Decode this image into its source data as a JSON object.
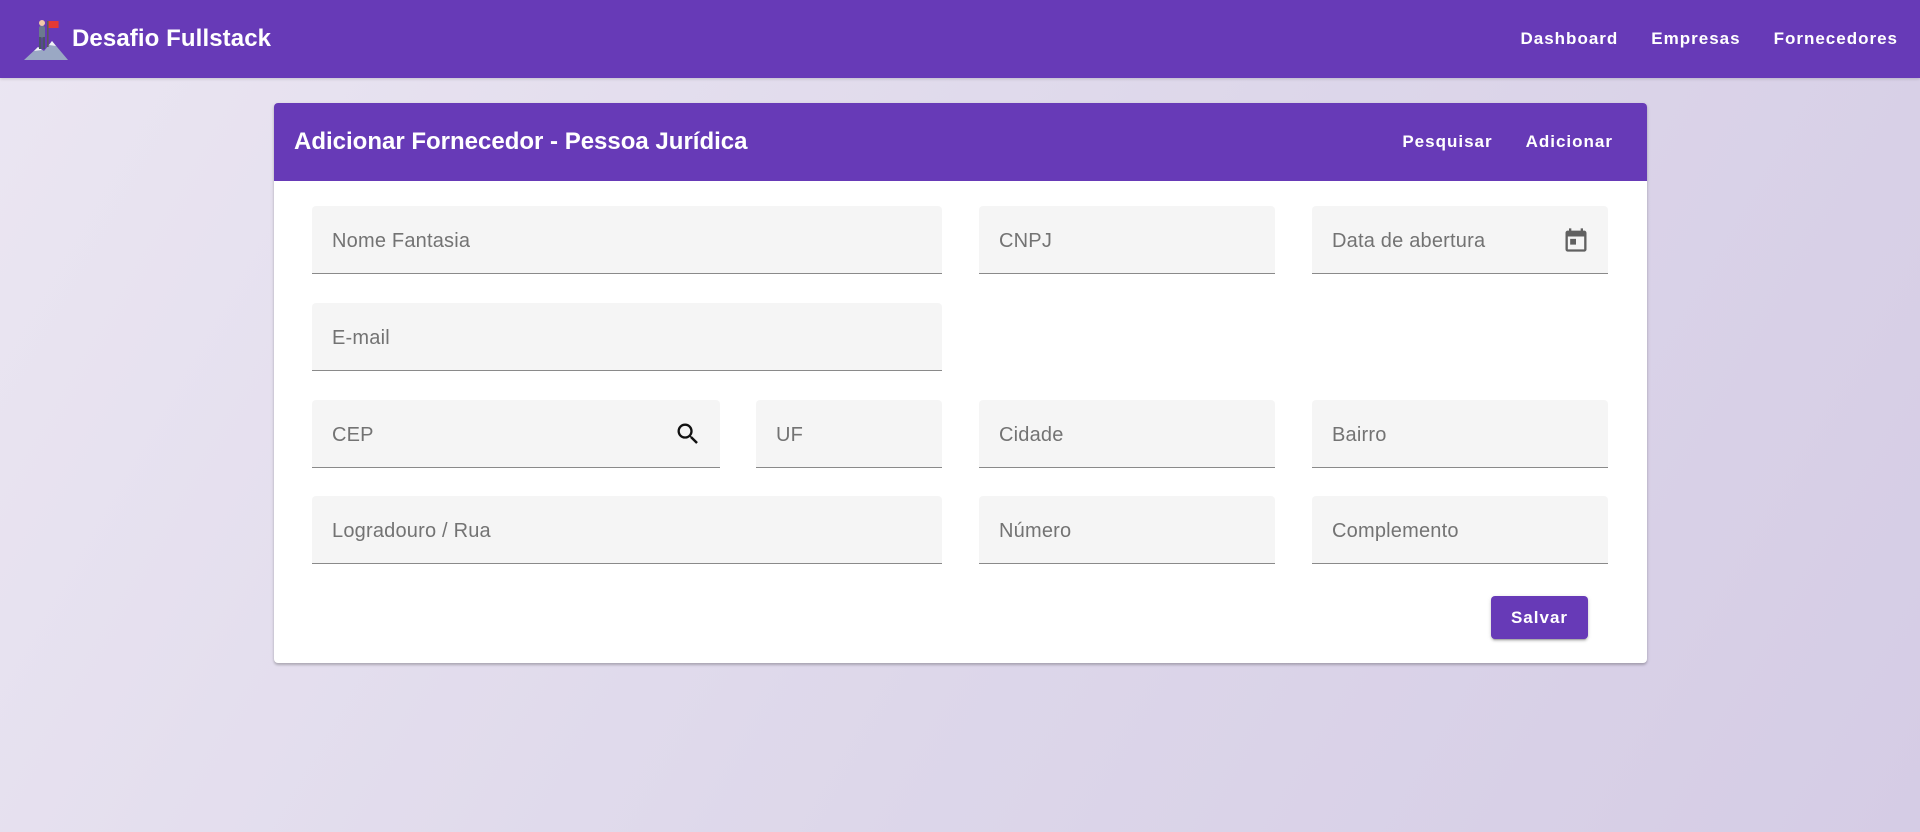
{
  "app": {
    "title": "Desafio Fullstack",
    "nav": {
      "dashboard": "Dashboard",
      "empresas": "Empresas",
      "fornecedores": "Fornecedores"
    },
    "colors": {
      "primary": "#673ab7"
    }
  },
  "card": {
    "title": "Adicionar Fornecedor - Pessoa Jurídica",
    "actions": {
      "search": "Pesquisar",
      "add": "Adicionar"
    }
  },
  "form": {
    "nome_fantasia": "Nome Fantasia",
    "cnpj": "CNPJ",
    "data_abertura": "Data de abertura",
    "email": "E-mail",
    "cep": "CEP",
    "uf": "UF",
    "cidade": "Cidade",
    "bairro": "Bairro",
    "logradouro": "Logradouro / Rua",
    "numero": "Número",
    "complemento": "Complemento",
    "icons": {
      "calendar": "calendar-icon",
      "search": "search-icon"
    },
    "save_label": "Salvar"
  }
}
